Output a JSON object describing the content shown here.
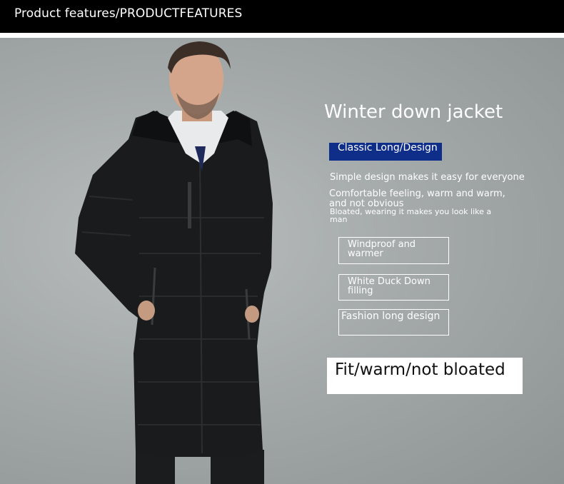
{
  "header": {
    "title": "Product features/PRODUCTFEATURES"
  },
  "product": {
    "headline": "Winter down jacket",
    "tag": "Classic Long/Design",
    "descriptions": [
      "Simple design makes it easy for everyone",
      "Comfortable feeling, warm and warm, and not obvious",
      "Bloated, wearing it makes you look like a man"
    ],
    "features": [
      "Windproof and warmer",
      "White Duck Down filling",
      "Fashion long design"
    ],
    "slogan": "Fit/warm/not bloated"
  },
  "colors": {
    "header_bg": "#000000",
    "tag_bg": "#0f2e8a",
    "stage_bg": "#a4a9a9"
  }
}
